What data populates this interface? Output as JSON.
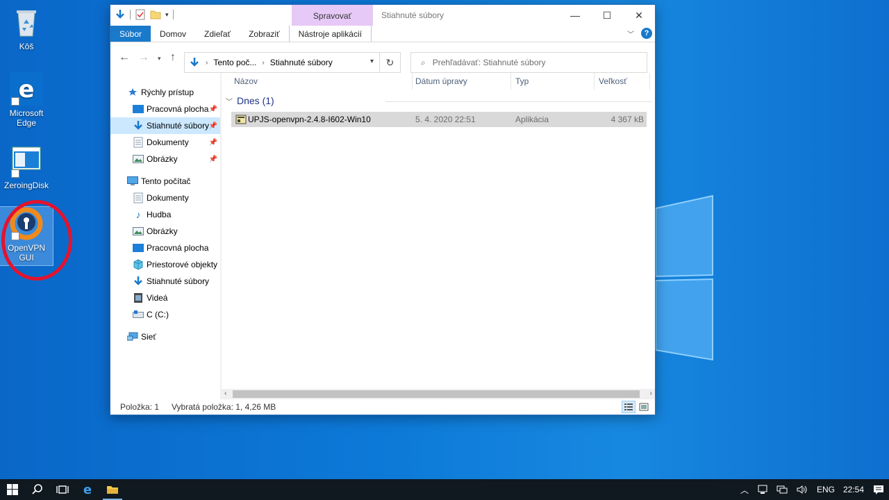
{
  "desktop": {
    "icons": [
      {
        "label": "Kôš"
      },
      {
        "label": "Microsoft Edge"
      },
      {
        "label": "ZeroingDisk"
      },
      {
        "label": "OpenVPN GUI"
      }
    ]
  },
  "window": {
    "title": "Stiahnuté súbory",
    "context_tab_header": "Spravovať",
    "ribbon_tabs": [
      "Súbor",
      "Domov",
      "Zdieľať",
      "Zobraziť",
      "Nástroje aplikácií"
    ],
    "address": {
      "crumbs": [
        "Tento poč...",
        "Stiahnuté súbory"
      ]
    },
    "search": {
      "placeholder": "Prehľadávať: Stiahnuté súbory"
    },
    "nav": {
      "quick_access": "Rýchly prístup",
      "quick_items": [
        "Pracovná plocha",
        "Stiahnuté súbory",
        "Dokumenty",
        "Obrázky"
      ],
      "this_pc": "Tento počítač",
      "pc_items": [
        "Dokumenty",
        "Hudba",
        "Obrázky",
        "Pracovná plocha",
        "Priestorové objekty",
        "Stiahnuté súbory",
        "Videá",
        "C (C:)"
      ],
      "network": "Sieť"
    },
    "columns": [
      "Názov",
      "Dátum úpravy",
      "Typ",
      "Veľkosť"
    ],
    "group_label": "Dnes (1)",
    "files": [
      {
        "name": "UPJS-openvpn-2.4.8-I602-Win10",
        "date": "5. 4. 2020 22:51",
        "type": "Aplikácia",
        "size": "4 367 kB"
      }
    ],
    "status": {
      "count": "Položka: 1",
      "selected": "Vybratá položka: 1, 4,26 MB"
    }
  },
  "taskbar": {
    "lang": "ENG",
    "time": "22:54"
  },
  "colors": {
    "desktop_bg": "#0d7ad8",
    "accent": "#1979ca",
    "selection": "#cce8ff",
    "context_tab": "#e6c9f6",
    "annotation_circle": "#e3132e"
  }
}
